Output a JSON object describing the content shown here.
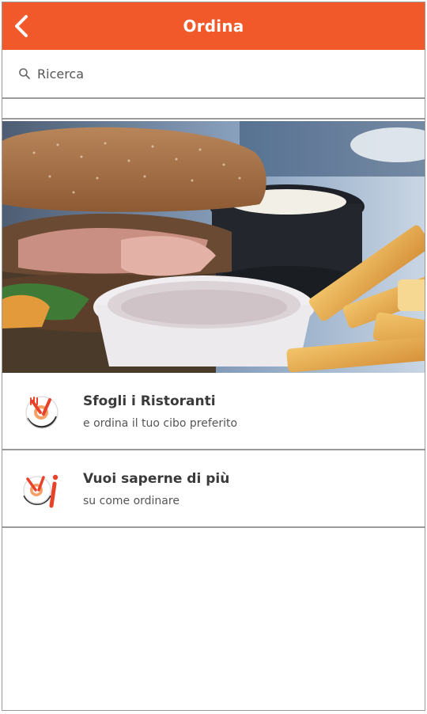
{
  "header": {
    "title": "Ordina",
    "back_icon": "chevron-left-icon",
    "color": "#f1592a"
  },
  "search": {
    "placeholder": "Ricerca",
    "icon": "search-icon"
  },
  "hero": {
    "icon": "burger-fries-photo"
  },
  "list": [
    {
      "title": "Sfogli i Ristoranti",
      "subtitle": "e ordina il tuo cibo preferito",
      "icon": "plate-fork-icon"
    },
    {
      "title": "Vuoi saperne di più",
      "subtitle": "su come ordinare",
      "icon": "plate-info-icon"
    }
  ]
}
